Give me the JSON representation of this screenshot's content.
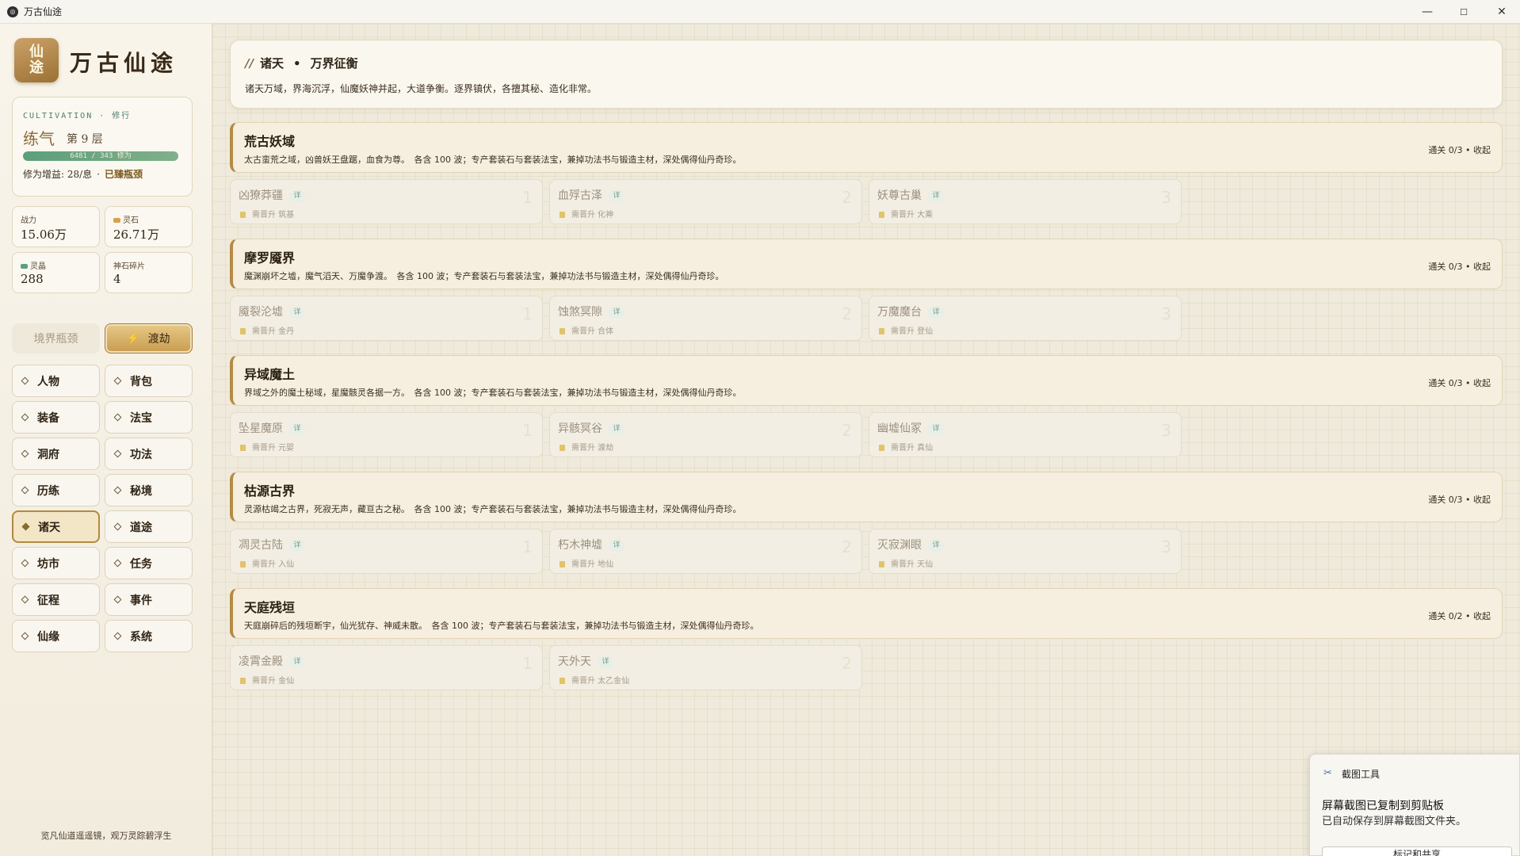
{
  "window": {
    "title": "万古仙途",
    "minimize": "—",
    "maximize": "☐",
    "close": "✕"
  },
  "sidebar": {
    "logo_text": "仙途",
    "app_title": "万古仙途",
    "cultivation": {
      "tag": "CULTIVATION · 修行",
      "realm": "练气",
      "layer": "第 9 层",
      "progress_text": "6481 / 343 修为",
      "progress_fraction": 1.0,
      "gain": "修为增益: 28/息",
      "status": "已臻瓶颈"
    },
    "stats": [
      {
        "label": "战力",
        "value": "15.06万"
      },
      {
        "label": "灵石",
        "value": "26.71万"
      },
      {
        "label": "灵晶",
        "value": "288"
      },
      {
        "label": "神石碎片",
        "value": "4"
      }
    ],
    "bottleneck_button": "境界瓶颈",
    "tribulation_button": "渡劫",
    "nav": [
      "人物",
      "背包",
      "装备",
      "法宝",
      "洞府",
      "功法",
      "历练",
      "秘境",
      "诸天",
      "道途",
      "坊市",
      "任务",
      "征程",
      "事件",
      "仙缘",
      "系统"
    ],
    "active_nav": "诸天",
    "motto": "览凡仙道遥遥镜，观万灵踪碧浮生"
  },
  "header": {
    "slashes": "//",
    "title_a": "诸天",
    "sep": "•",
    "title_b": "万界征衡",
    "subtitle": "诸天万域，界海沉浮，仙魔妖神并起，大道争衡。逐界镇伏，各擅其秘、造化非常。"
  },
  "regions": [
    {
      "name": "荒古妖域",
      "desc": "太古蛮荒之域，凶兽妖王盘踞，血食为尊。　各含 100 波；专产套装石与套装法宝，兼掉功法书与锻造主材，深处偶得仙丹奇珍。",
      "stat": "通关 0/3 • 收起",
      "stages": [
        {
          "name": "凶獠莽疆",
          "badge": "详",
          "req": "需晋升 筑基",
          "num": "1"
        },
        {
          "name": "血殍古泽",
          "badge": "详",
          "req": "需晋升 化神",
          "num": "2"
        },
        {
          "name": "妖尊古巢",
          "badge": "详",
          "req": "需晋升 大乘",
          "num": "3"
        }
      ]
    },
    {
      "name": "摩罗魇界",
      "desc": "魔渊崩坏之墟，魔气滔天、万魔争渡。　各含 100 波；专产套装石与套装法宝，兼掉功法书与锻造主材，深处偶得仙丹奇珍。",
      "stat": "通关 0/3 • 收起",
      "stages": [
        {
          "name": "魇裂沦墟",
          "badge": "详",
          "req": "需晋升 金丹",
          "num": "1"
        },
        {
          "name": "蚀煞冥隙",
          "badge": "详",
          "req": "需晋升 合体",
          "num": "2"
        },
        {
          "name": "万魔魔台",
          "badge": "详",
          "req": "需晋升 登仙",
          "num": "3"
        }
      ]
    },
    {
      "name": "异域魔土",
      "desc": "界域之外的魔土秘域，星魔骸灵各据一方。　各含 100 波；专产套装石与套装法宝，兼掉功法书与锻造主材，深处偶得仙丹奇珍。",
      "stat": "通关 0/3 • 收起",
      "stages": [
        {
          "name": "坠星魔原",
          "badge": "详",
          "req": "需晋升 元婴",
          "num": "1"
        },
        {
          "name": "异骸冥谷",
          "badge": "详",
          "req": "需晋升 渡劫",
          "num": "2"
        },
        {
          "name": "幽墟仙冢",
          "badge": "详",
          "req": "需晋升 真仙",
          "num": "3"
        }
      ]
    },
    {
      "name": "枯源古界",
      "desc": "灵源枯竭之古界，死寂无声，藏亘古之秘。　各含 100 波；专产套装石与套装法宝，兼掉功法书与锻造主材，深处偶得仙丹奇珍。",
      "stat": "通关 0/3 • 收起",
      "stages": [
        {
          "name": "凋灵古陆",
          "badge": "详",
          "req": "需晋升 入仙",
          "num": "1"
        },
        {
          "name": "朽木神墟",
          "badge": "详",
          "req": "需晋升 地仙",
          "num": "2"
        },
        {
          "name": "灭寂渊眼",
          "badge": "详",
          "req": "需晋升 天仙",
          "num": "3"
        }
      ]
    },
    {
      "name": "天庭残垣",
      "desc": "天庭崩碎后的残垣断宇，仙光犹存、神威未散。　各含 100 波；专产套装石与套装法宝，兼掉功法书与锻造主材，深处偶得仙丹奇珍。",
      "stat": "通关 0/2 • 收起",
      "stages": [
        {
          "name": "凌霄金殿",
          "badge": "详",
          "req": "需晋升 金仙",
          "num": "1"
        },
        {
          "name": "天外天",
          "badge": "详",
          "req": "需晋升 太乙金仙",
          "num": "2"
        }
      ]
    }
  ],
  "toast": {
    "app": "截图工具",
    "title": "屏幕截图已复制到剪贴板",
    "body": "已自动保存到屏幕截图文件夹。",
    "button": "标记和共享"
  },
  "colors": {
    "accent": "#b58a45",
    "jade": "#5c9e7c",
    "background": "#efeadb"
  }
}
